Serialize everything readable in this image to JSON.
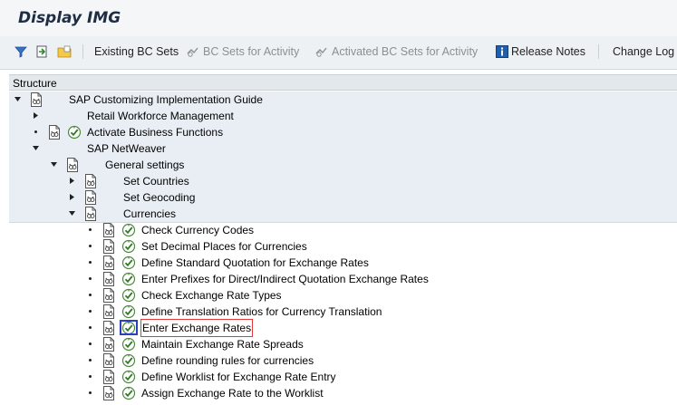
{
  "window": {
    "title": "Display IMG"
  },
  "toolbar": {
    "existing_bc_sets": "Existing BC Sets",
    "bc_sets_for_activity": "BC Sets for Activity",
    "activated_bc_sets": "Activated BC Sets for Activity",
    "release_notes": "Release Notes",
    "change_log": "Change Log"
  },
  "structure": {
    "header": "Structure"
  },
  "tree": [
    {
      "label": "SAP Customizing Implementation Guide",
      "level": 0,
      "toggle": "expanded",
      "doc": true,
      "exec": false
    },
    {
      "label": "Retail Workforce Management",
      "level": 1,
      "toggle": "collapsed",
      "doc": false,
      "exec": false
    },
    {
      "label": "Activate Business Functions",
      "level": 1,
      "toggle": "leaf",
      "doc": true,
      "exec": true
    },
    {
      "label": "SAP NetWeaver",
      "level": 1,
      "toggle": "expanded",
      "doc": false,
      "exec": false
    },
    {
      "label": "General settings",
      "level": 2,
      "toggle": "expanded",
      "doc": true,
      "exec": false
    },
    {
      "label": "Set Countries",
      "level": 3,
      "toggle": "collapsed",
      "doc": true,
      "exec": false
    },
    {
      "label": "Set Geocoding",
      "level": 3,
      "toggle": "collapsed",
      "doc": true,
      "exec": false
    },
    {
      "label": "Currencies",
      "level": 3,
      "toggle": "expanded",
      "doc": true,
      "exec": false
    },
    {
      "label": "Check Currency Codes",
      "level": 4,
      "toggle": "leaf",
      "doc": true,
      "exec": true
    },
    {
      "label": "Set Decimal Places for Currencies",
      "level": 4,
      "toggle": "leaf",
      "doc": true,
      "exec": true
    },
    {
      "label": "Define Standard Quotation for Exchange Rates",
      "level": 4,
      "toggle": "leaf",
      "doc": true,
      "exec": true
    },
    {
      "label": "Enter Prefixes for Direct/Indirect Quotation Exchange Rates",
      "level": 4,
      "toggle": "leaf",
      "doc": true,
      "exec": true
    },
    {
      "label": "Check Exchange Rate Types",
      "level": 4,
      "toggle": "leaf",
      "doc": true,
      "exec": true
    },
    {
      "label": "Define Translation Ratios for Currency Translation",
      "level": 4,
      "toggle": "leaf",
      "doc": true,
      "exec": true
    },
    {
      "label": "Enter Exchange Rates",
      "level": 4,
      "toggle": "leaf",
      "doc": true,
      "exec": true,
      "selected": true
    },
    {
      "label": "Maintain Exchange Rate Spreads",
      "level": 4,
      "toggle": "leaf",
      "doc": true,
      "exec": true
    },
    {
      "label": "Define rounding rules for currencies",
      "level": 4,
      "toggle": "leaf",
      "doc": true,
      "exec": true
    },
    {
      "label": "Define Worklist for Exchange Rate Entry",
      "level": 4,
      "toggle": "leaf",
      "doc": true,
      "exec": true
    },
    {
      "label": "Assign Exchange Rate to the Worklist",
      "level": 4,
      "toggle": "leaf",
      "doc": true,
      "exec": true
    }
  ]
}
